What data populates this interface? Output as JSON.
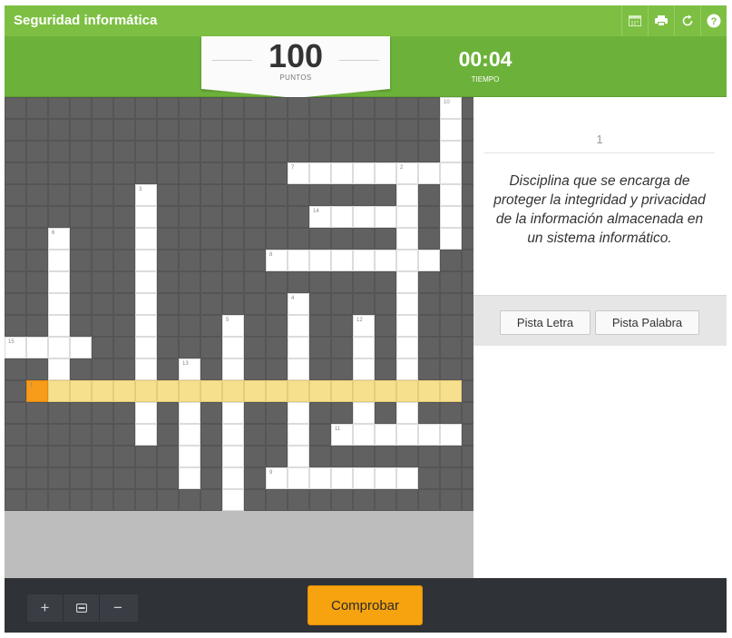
{
  "header": {
    "title": "Seguridad informática",
    "tools": [
      {
        "name": "solutions-icon"
      },
      {
        "name": "print-icon"
      },
      {
        "name": "restart-icon"
      },
      {
        "name": "help-icon"
      }
    ]
  },
  "score": {
    "points": "100",
    "points_label": "PUNTOS",
    "time": "00:04",
    "time_label": "TIEMPO"
  },
  "colors": {
    "accent": "#7dbf43",
    "accent_dark": "#6cb23a",
    "active_word": "#f6e08d",
    "cursor": "#f79b1a",
    "check_button": "#f6a30f"
  },
  "crossword": {
    "rows": 19,
    "cols": 21,
    "words": [
      {
        "num": "10",
        "row": 0,
        "col": 20,
        "dir": "down",
        "length": 7
      },
      {
        "num": "7",
        "row": 3,
        "col": 13,
        "dir": "across",
        "length": 8
      },
      {
        "num": "2",
        "row": 3,
        "col": 18,
        "dir": "down",
        "length": 13
      },
      {
        "num": "3",
        "row": 4,
        "col": 6,
        "dir": "down",
        "length": 12
      },
      {
        "num": "14",
        "row": 5,
        "col": 14,
        "dir": "across",
        "length": 5
      },
      {
        "num": "6",
        "row": 6,
        "col": 2,
        "dir": "down",
        "length": 7
      },
      {
        "num": "8",
        "row": 7,
        "col": 12,
        "dir": "across",
        "length": 8
      },
      {
        "num": "4",
        "row": 9,
        "col": 13,
        "dir": "down",
        "length": 8
      },
      {
        "num": "5",
        "row": 10,
        "col": 10,
        "dir": "down",
        "length": 9
      },
      {
        "num": "12",
        "row": 10,
        "col": 16,
        "dir": "down",
        "length": 5
      },
      {
        "num": "15",
        "row": 11,
        "col": 0,
        "dir": "across",
        "length": 4
      },
      {
        "num": "13",
        "row": 12,
        "col": 8,
        "dir": "down",
        "length": 6
      },
      {
        "num": "1",
        "row": 13,
        "col": 1,
        "dir": "across",
        "length": 20
      },
      {
        "num": "11",
        "row": 15,
        "col": 15,
        "dir": "across",
        "length": 6
      },
      {
        "num": "9",
        "row": 17,
        "col": 12,
        "dir": "across",
        "length": 7
      }
    ],
    "active_word": "1",
    "cursor": {
      "row": 13,
      "col": 1
    }
  },
  "clue": {
    "number": "1",
    "text": "Disciplina que se encarga de proteger la integridad y privacidad de la información almacenada en un sistema informático."
  },
  "hints": {
    "letter": "Pista Letra",
    "word": "Pista Palabra"
  },
  "footer": {
    "zoom_in": "+",
    "zoom_out": "−",
    "check": "Comprobar"
  }
}
